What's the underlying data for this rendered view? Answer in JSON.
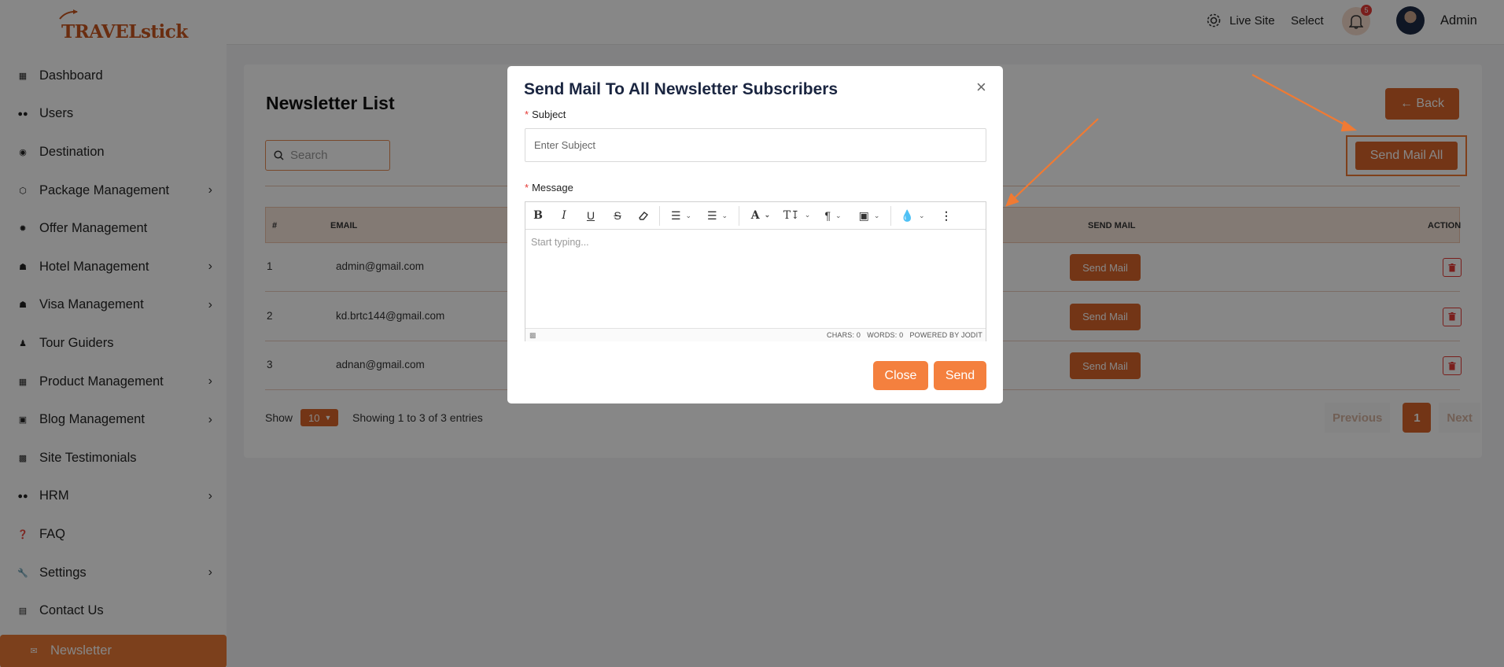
{
  "brand": {
    "logo_text": "TRAVELstick",
    "color": "#d9652a"
  },
  "sidebar": {
    "items": [
      {
        "label": "Dashboard",
        "icon": "dashboard-icon",
        "chevron": false
      },
      {
        "label": "Users",
        "icon": "users-icon",
        "chevron": false
      },
      {
        "label": "Destination",
        "icon": "map-pin-icon",
        "chevron": false
      },
      {
        "label": "Package Management",
        "icon": "package-icon",
        "chevron": true
      },
      {
        "label": "Offer Management",
        "icon": "offer-icon",
        "chevron": false
      },
      {
        "label": "Hotel Management",
        "icon": "hotel-icon",
        "chevron": true
      },
      {
        "label": "Visa Management",
        "icon": "visa-icon",
        "chevron": true
      },
      {
        "label": "Tour Guiders",
        "icon": "guide-icon",
        "chevron": false
      },
      {
        "label": "Product Management",
        "icon": "grid-icon",
        "chevron": true
      },
      {
        "label": "Blog Management",
        "icon": "blog-icon",
        "chevron": true
      },
      {
        "label": "Site Testimonials",
        "icon": "comment-icon",
        "chevron": false
      },
      {
        "label": "HRM",
        "icon": "team-icon",
        "chevron": true
      },
      {
        "label": "FAQ",
        "icon": "question-icon",
        "chevron": false
      },
      {
        "label": "Settings",
        "icon": "wrench-icon",
        "chevron": true
      },
      {
        "label": "Contact Us",
        "icon": "contact-card-icon",
        "chevron": false
      },
      {
        "label": "Newsletter",
        "icon": "envelope-icon",
        "chevron": false,
        "active": true
      }
    ]
  },
  "topbar": {
    "live_site": "Live Site",
    "select": "Select",
    "notification_count": "5",
    "user_name": "Admin"
  },
  "page": {
    "title": "Newsletter List",
    "back_label": "← Back",
    "send_all_label": "Send Mail All",
    "search_placeholder": "Search",
    "columns": {
      "num": "#",
      "email": "EMAIL",
      "send_mail": "SEND MAIL",
      "action": "ACTION"
    },
    "rows": [
      {
        "num": "1",
        "email": "admin@gmail.com",
        "send_label": "Send Mail"
      },
      {
        "num": "2",
        "email": "kd.brtc144@gmail.com",
        "send_label": "Send Mail"
      },
      {
        "num": "3",
        "email": "adnan@gmail.com",
        "send_label": "Send Mail"
      }
    ],
    "show_label": "Show",
    "page_length": "10",
    "entries_info": "Showing 1 to 3 of 3 entries",
    "pagination": {
      "previous": "Previous",
      "current": "1",
      "next": "Next"
    }
  },
  "modal": {
    "title": "Send Mail To All Newsletter Subscribers",
    "close_x": "×",
    "subject_label": "Subject",
    "subject_placeholder": "Enter Subject",
    "message_label": "Message",
    "editor_placeholder": "Start typing...",
    "status": {
      "chars": "CHARS: 0",
      "words": "WORDS: 0",
      "powered": "POWERED BY JODIT"
    },
    "close_label": "Close",
    "send_label": "Send"
  },
  "annotation_color": "#f07a33"
}
